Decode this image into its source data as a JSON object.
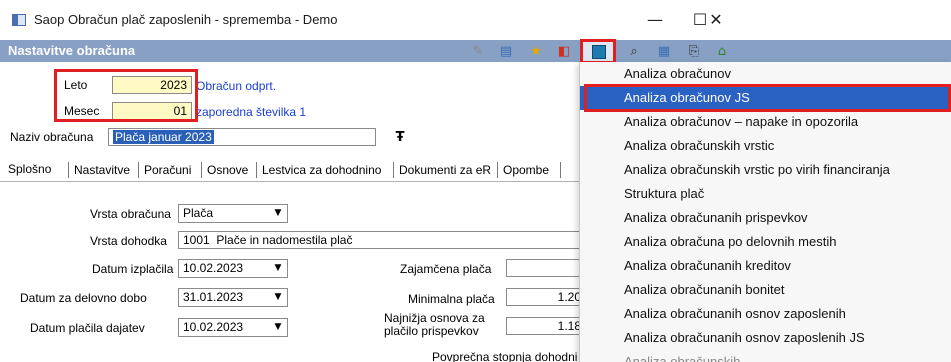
{
  "window": {
    "title": "Saop Obračun plač zaposlenih - sprememba - Demo",
    "minimize": "—",
    "maximize": "☐",
    "close": "✕"
  },
  "section": {
    "title": "Nastavitve obračuna"
  },
  "header_form": {
    "leto_label": "Leto",
    "leto_value": "2023",
    "leto_link": "Obračun odprt.",
    "mesec_label": "Mesec",
    "mesec_value": "01",
    "mesec_link": "zaporedna številka 1",
    "naziv_label": "Naziv obračuna",
    "naziv_value": "Plača januar 2023"
  },
  "tabs": [
    {
      "label": "Splošno"
    },
    {
      "label": "Nastavitve"
    },
    {
      "label": "Poračuni"
    },
    {
      "label": "Osnove"
    },
    {
      "label": "Lestvica za dohodnino"
    },
    {
      "label": "Dokumenti za eR"
    },
    {
      "label": "Opombe"
    }
  ],
  "general": {
    "vrsta_obracuna_label": "Vrsta obračuna",
    "vrsta_obracuna_value": "Plača",
    "vrsta_dohodka_label": "Vrsta dohodka",
    "vrsta_dohodka_value": "1001  Plače in nadomestila plač",
    "datum_izplacila_label": "Datum izplačila",
    "datum_izplacila_value": "10.02.2023",
    "datum_delovno_label": "Datum za delovno dobo",
    "datum_delovno_value": "31.01.2023",
    "datum_placila_label": "Datum plačila dajatev",
    "datum_placila_value": "10.02.2023",
    "zajamcena_label": "Zajamčena plača",
    "zajamcena_value": "",
    "minimalna_label": "Minimalna plača",
    "minimalna_value": "1.20",
    "najnizja_label_1": "Najnižja osnova za",
    "najnizja_label_2": "plačilo prispevkov",
    "najnizja_value": "1.18",
    "povprecna_label": "Povprečna stopnja dohodni"
  },
  "menu": {
    "items": [
      {
        "label": "Analiza obračunov"
      },
      {
        "label": "Analiza obračunov JS"
      },
      {
        "label": "Analiza obračunov – napake in opozorila"
      },
      {
        "label": "Analiza obračunskih vrstic"
      },
      {
        "label": "Analiza obračunskih vrstic po virih financiranja"
      },
      {
        "label": "Struktura plač"
      },
      {
        "label": "Analiza obračunanih prispevkov"
      },
      {
        "label": "Analiza obračuna po delovnih mestih"
      },
      {
        "label": "Analiza obračunanih kreditov"
      },
      {
        "label": "Analiza obračunanih bonitet"
      },
      {
        "label": "Analiza obračunanih osnov zaposlenih"
      },
      {
        "label": "Analiza obračunanih osnov zaposlenih JS"
      },
      {
        "label": "Analiza obračunskih ..."
      }
    ],
    "highlighted_index": 1
  },
  "colors": {
    "section_bar": "#87a0c3",
    "highlight": "#2a62c4",
    "annotation": "#e02020",
    "input_yellow": "#fff9c4",
    "link": "#1a3ecf"
  }
}
